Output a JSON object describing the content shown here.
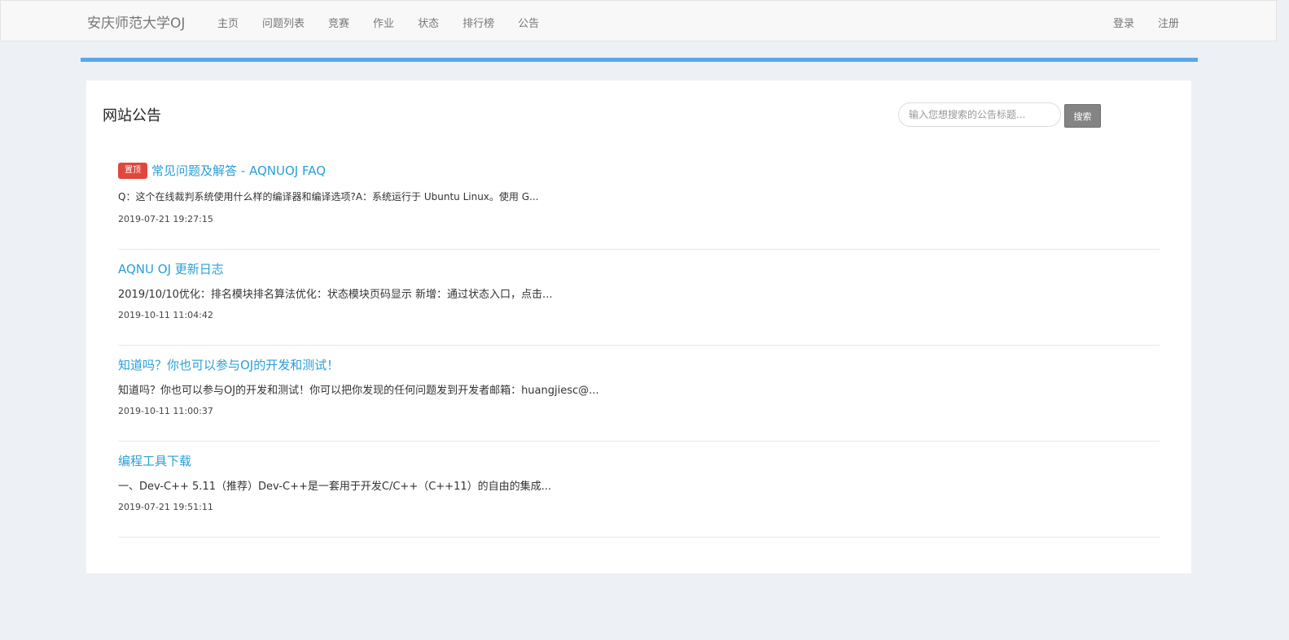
{
  "navbar": {
    "brand": "安庆师范大学OJ",
    "links": [
      "主页",
      "问题列表",
      "竞赛",
      "作业",
      "状态",
      "排行榜",
      "公告"
    ],
    "login": "登录",
    "register": "注册"
  },
  "panel": {
    "title": "网站公告",
    "search_placeholder": "输入您想搜索的公告标题...",
    "search_button": "搜索"
  },
  "notices": [
    {
      "badge": "置顶",
      "title": "常见问题及解答 - AQNUOJ FAQ",
      "summary": "Q：这个在线裁判系统使用什么样的编译器和编译选项?A：系统运行于 Ubuntu Linux。使用 G...",
      "time": "2019-07-21 19:27:15"
    },
    {
      "badge": "",
      "title": "AQNU OJ 更新日志",
      "summary": "2019/10/10优化：排名模块排名算法优化：状态模块页码显示 新增：通过状态入口，点击...",
      "time": "2019-10-11 11:04:42"
    },
    {
      "badge": "",
      "title": "知道吗？你也可以参与OJ的开发和测试！",
      "summary": "知道吗？你也可以参与OJ的开发和测试！你可以把你发现的任何问题发到开发者邮箱：huangjiesc@...",
      "time": "2019-10-11 11:00:37"
    },
    {
      "badge": "",
      "title": "编程工具下载",
      "summary": "一、Dev-C++ 5.11（推荐）Dev-C++是一套用于开发C/C++（C++11）的自由的集成...",
      "time": "2019-07-21 19:51:11"
    }
  ],
  "colors": {
    "accent_bar": "#5aa7ec",
    "link": "#2a9fd8",
    "pin_badge": "#e0483e"
  }
}
